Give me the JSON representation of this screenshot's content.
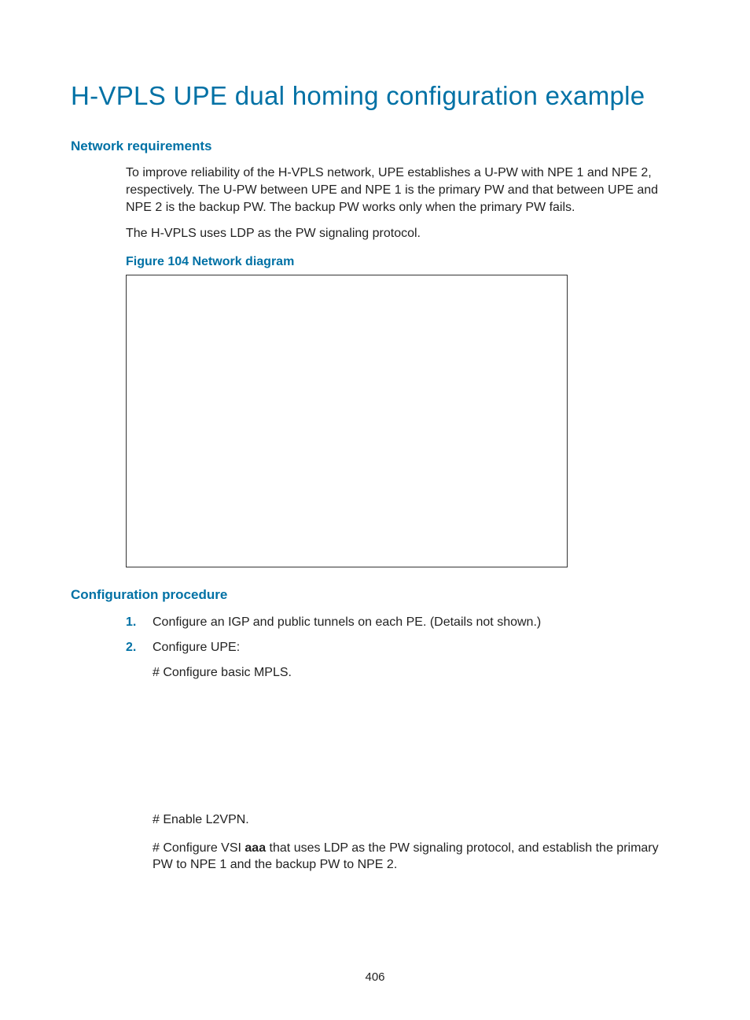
{
  "title": "H-VPLS UPE dual homing configuration example",
  "sections": {
    "network_requirements": {
      "heading": "Network requirements",
      "para1": "To improve reliability of the H-VPLS network, UPE establishes a U-PW with NPE 1 and NPE 2, respectively. The U-PW between UPE and NPE 1 is the primary PW and that between UPE and NPE 2 is the backup PW. The backup PW works only when the primary PW fails.",
      "para2": "The H-VPLS uses LDP as the PW signaling protocol.",
      "figure_caption": "Figure 104 Network diagram"
    },
    "config_procedure": {
      "heading": "Configuration procedure",
      "steps": [
        {
          "num": "1.",
          "text": "Configure an IGP and public tunnels on each PE. (Details not shown.)"
        },
        {
          "num": "2.",
          "text": "Configure UPE:"
        }
      ],
      "sub1": "# Configure basic MPLS.",
      "sub2": "# Enable L2VPN.",
      "sub3_pre": "# Configure VSI ",
      "sub3_bold": "aaa",
      "sub3_post": " that uses LDP as the PW signaling protocol, and establish the primary PW to NPE 1 and the backup PW to NPE 2."
    }
  },
  "page_number": "406"
}
